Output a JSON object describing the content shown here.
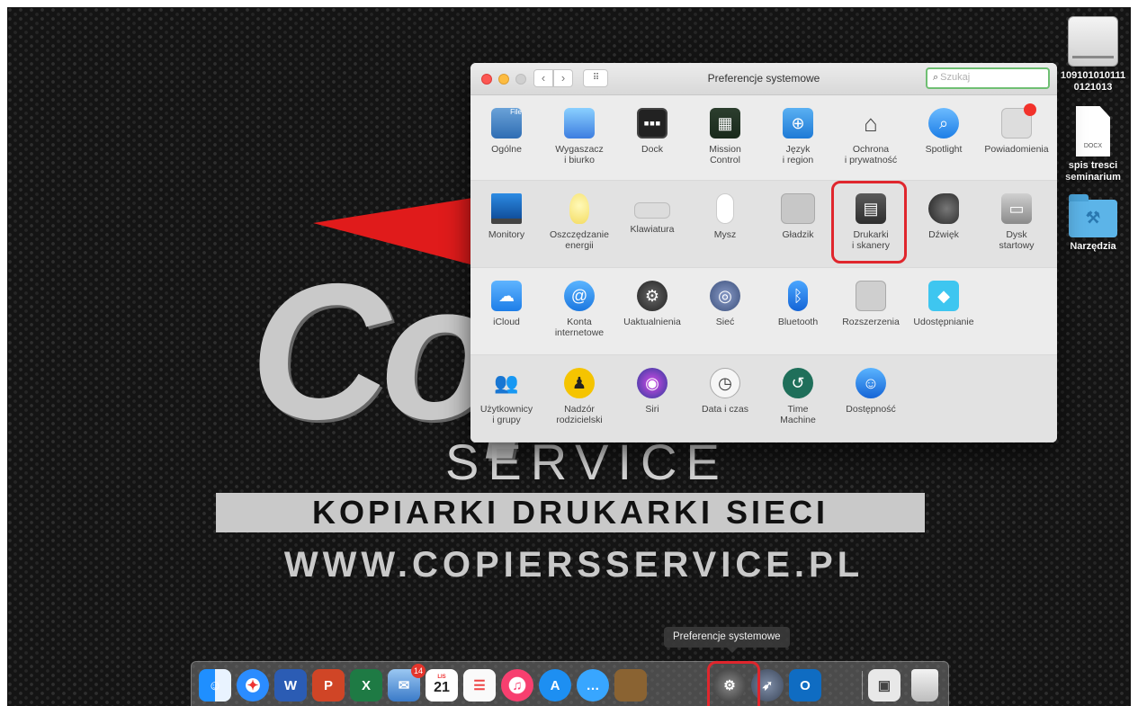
{
  "wallpaper": {
    "logo_text": "Cop",
    "service_text": "SERVICE",
    "tagline": "KOPIARKI  DRUKARKI  SIECI",
    "url": "WWW.COPIERSSERVICE.PL"
  },
  "desktop_icons": [
    {
      "label": "109101010111\n0121013",
      "icon": "hard-drive-icon"
    },
    {
      "label": "spis tresci\nseminarium",
      "icon": "document-icon",
      "file_type": "DOCX"
    },
    {
      "label": "Narzędzia",
      "icon": "folder-icon"
    }
  ],
  "window": {
    "title": "Preferencje systemowe",
    "search_placeholder": "Szukaj",
    "grid_glyph": "⠿",
    "nav_back": "‹",
    "nav_forward": "›",
    "rows": [
      [
        {
          "label": "Ogólne",
          "icon": "general-icon",
          "glyph": "File"
        },
        {
          "label": "Wygaszacz\ni biurko",
          "icon": "desktop-screensaver-icon",
          "glyph": ""
        },
        {
          "label": "Dock",
          "icon": "dock-icon",
          "glyph": "▪▪▪"
        },
        {
          "label": "Mission\nControl",
          "icon": "mission-control-icon",
          "glyph": "▦"
        },
        {
          "label": "Język\ni region",
          "icon": "language-region-icon",
          "glyph": "⊕"
        },
        {
          "label": "Ochrona\ni prywatność",
          "icon": "security-house-icon",
          "glyph": "⌂"
        },
        {
          "label": "Spotlight",
          "icon": "spotlight-icon",
          "glyph": "⌕"
        },
        {
          "label": "Powiadomienia",
          "icon": "notifications-icon",
          "glyph": ""
        }
      ],
      [
        {
          "label": "Monitory",
          "icon": "monitor-icon",
          "glyph": ""
        },
        {
          "label": "Oszczędzanie\nenergii",
          "icon": "lightbulb-icon",
          "glyph": ""
        },
        {
          "label": "Klawiatura",
          "icon": "keyboard-icon",
          "glyph": ""
        },
        {
          "label": "Mysz",
          "icon": "mouse-icon",
          "glyph": ""
        },
        {
          "label": "Gładzik",
          "icon": "trackpad-icon",
          "glyph": ""
        },
        {
          "label": "Drukarki\ni skanery",
          "icon": "printer-icon",
          "glyph": "▤"
        },
        {
          "label": "Dźwięk",
          "icon": "speaker-icon",
          "glyph": ""
        },
        {
          "label": "Dysk\nstartowy",
          "icon": "startup-disk-icon",
          "glyph": "▭"
        }
      ],
      [
        {
          "label": "iCloud",
          "icon": "icloud-icon",
          "glyph": "☁"
        },
        {
          "label": "Konta\ninternetowe",
          "icon": "at-sign-icon",
          "glyph": "@"
        },
        {
          "label": "Uaktualnienia",
          "icon": "software-update-gear-icon",
          "glyph": "⚙"
        },
        {
          "label": "Sieć",
          "icon": "network-globe-icon",
          "glyph": "◎"
        },
        {
          "label": "Bluetooth",
          "icon": "bluetooth-icon",
          "glyph": "ᛒ"
        },
        {
          "label": "Rozszerzenia",
          "icon": "puzzle-piece-icon",
          "glyph": ""
        },
        {
          "label": "Udostępnianie",
          "icon": "sharing-sign-icon",
          "glyph": "◆"
        }
      ],
      [
        {
          "label": "Użytkownicy\ni grupy",
          "icon": "users-icon",
          "glyph": "👥"
        },
        {
          "label": "Nadzór\nrodzicielski",
          "icon": "parental-controls-icon",
          "glyph": "♟"
        },
        {
          "label": "Siri",
          "icon": "siri-icon",
          "glyph": "◉"
        },
        {
          "label": "Data i czas",
          "icon": "clock-calendar-icon",
          "glyph": "◷"
        },
        {
          "label": "Time\nMachine",
          "icon": "time-machine-icon",
          "glyph": "↺"
        },
        {
          "label": "Dostępność",
          "icon": "accessibility-icon",
          "glyph": "☺"
        }
      ]
    ]
  },
  "dock": {
    "tooltip": "Preferencje systemowe",
    "items": [
      {
        "name": "finder",
        "glyph": "☺"
      },
      {
        "name": "safari",
        "glyph": "✦"
      },
      {
        "name": "word",
        "glyph": "W"
      },
      {
        "name": "powerpoint",
        "glyph": "P"
      },
      {
        "name": "excel",
        "glyph": "X"
      },
      {
        "name": "mail",
        "glyph": "✉",
        "badge": "14"
      },
      {
        "name": "calendar",
        "glyph": "21",
        "month": "LIS"
      },
      {
        "name": "reminders",
        "glyph": "☰"
      },
      {
        "name": "music",
        "glyph": "♫"
      },
      {
        "name": "app-store",
        "glyph": "A"
      },
      {
        "name": "messages",
        "glyph": "…"
      },
      {
        "name": "book",
        "glyph": ""
      },
      {
        "name": "system-preferences",
        "glyph": "⚙"
      },
      {
        "name": "launchpad",
        "glyph": "➶"
      },
      {
        "name": "outlook",
        "glyph": "O"
      },
      {
        "name": "preview",
        "glyph": "▣"
      },
      {
        "name": "trash",
        "glyph": ""
      }
    ]
  },
  "colors": {
    "highlight": "#e0262d",
    "search_focus": "#6fbf73"
  }
}
